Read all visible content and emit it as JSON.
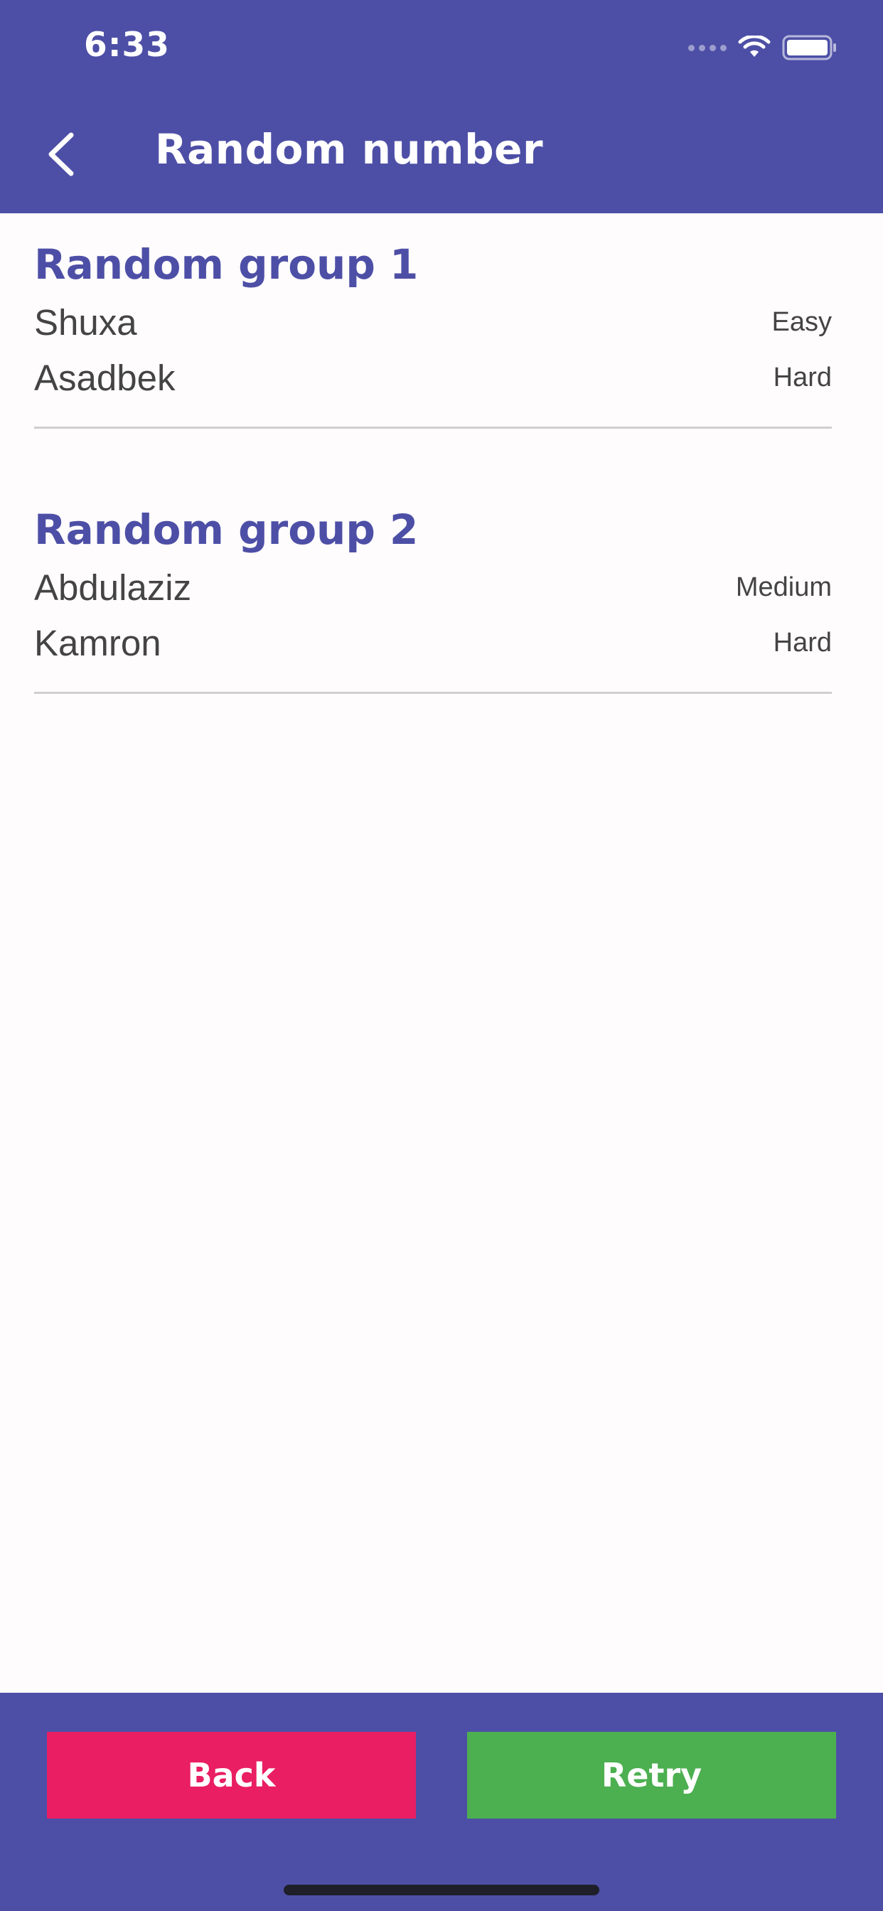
{
  "status_bar": {
    "time": "6:33"
  },
  "app_bar": {
    "title": "Random number",
    "back_icon": "chevron-left-icon"
  },
  "groups": [
    {
      "title": "Random group 1",
      "members": [
        {
          "name": "Shuxa",
          "level": "Easy"
        },
        {
          "name": "Asadbek",
          "level": "Hard"
        }
      ]
    },
    {
      "title": "Random group 2",
      "members": [
        {
          "name": "Abdulaziz",
          "level": "Medium"
        },
        {
          "name": "Kamron",
          "level": "Hard"
        }
      ]
    }
  ],
  "actions": {
    "back_label": "Back",
    "retry_label": "Retry"
  },
  "colors": {
    "primary": "#4d4fa6",
    "back_button": "#e91e63",
    "retry_button": "#4caf50",
    "background": "#fffcfd"
  }
}
